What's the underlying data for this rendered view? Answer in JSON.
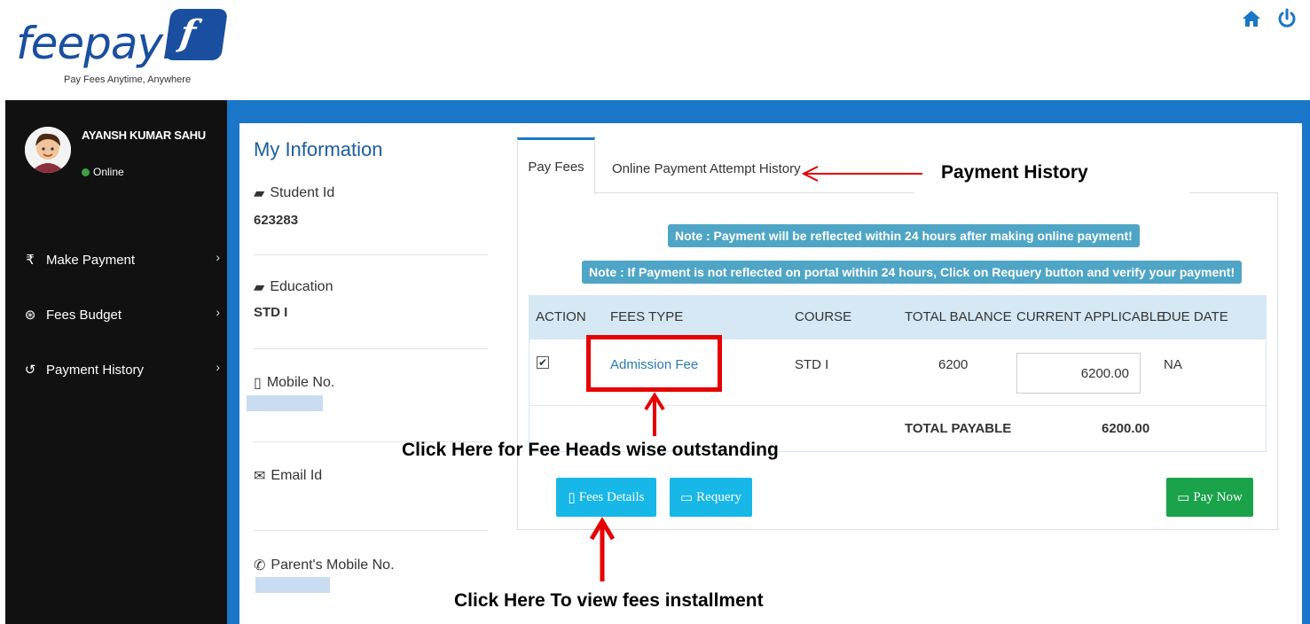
{
  "brand": {
    "name": "feepayr",
    "mark": "f",
    "tagline": "Pay Fees Anytime, Anywhere"
  },
  "header_icons": [
    "home-icon",
    "power-icon"
  ],
  "sidebar": {
    "user_name": "AYANSH KUMAR SAHU",
    "status": "Online",
    "items": [
      {
        "icon": "rupee-icon",
        "glyph": "₹",
        "label": "Make Payment"
      },
      {
        "icon": "dashboard-icon",
        "glyph": "⊛",
        "label": "Fees Budget"
      },
      {
        "icon": "history-icon",
        "glyph": "↺",
        "label": "Payment History"
      }
    ]
  },
  "info": {
    "title": "My Information",
    "student_id_label": "Student Id",
    "student_id": "623283",
    "education_label": "Education",
    "education": "STD I",
    "mobile_label": "Mobile No.",
    "email_label": "Email Id",
    "parent_mobile_label": "Parent's Mobile No."
  },
  "tabs": {
    "pay_fees": "Pay Fees",
    "history": "Online Payment Attempt History"
  },
  "notes": {
    "note1": "Note : Payment will be reflected within 24 hours after making online payment!",
    "note2": "Note : If Payment is not reflected on portal within 24 hours, Click on Requery button and verify your payment!"
  },
  "table": {
    "headers": [
      "ACTION",
      "FEES TYPE",
      "COURSE",
      "TOTAL BALANCE",
      "CURRENT APPLICABLE",
      "DUE DATE"
    ],
    "row": {
      "checked": "✔",
      "fees_type": "Admission Fee",
      "course": "STD I",
      "total_balance": "6200",
      "current_applicable": "6200.00",
      "due_date": "NA"
    },
    "total_label": "TOTAL PAYABLE",
    "total_value": "6200.00"
  },
  "buttons": {
    "fees_details": "Fees Details",
    "requery": "Requery",
    "pay_now": "Pay Now"
  },
  "annotations": {
    "payment_history": "Payment History",
    "fee_heads": "Click Here for Fee Heads wise outstanding",
    "installment": "Click Here To view fees installment"
  },
  "colors": {
    "brand_blue": "#1a4fa0",
    "frame_blue": "#1976c8",
    "note_bg": "#4fa5c6",
    "info_btn": "#17b7e8",
    "success_btn": "#1aa34a",
    "annotation_red": "#e60000"
  }
}
